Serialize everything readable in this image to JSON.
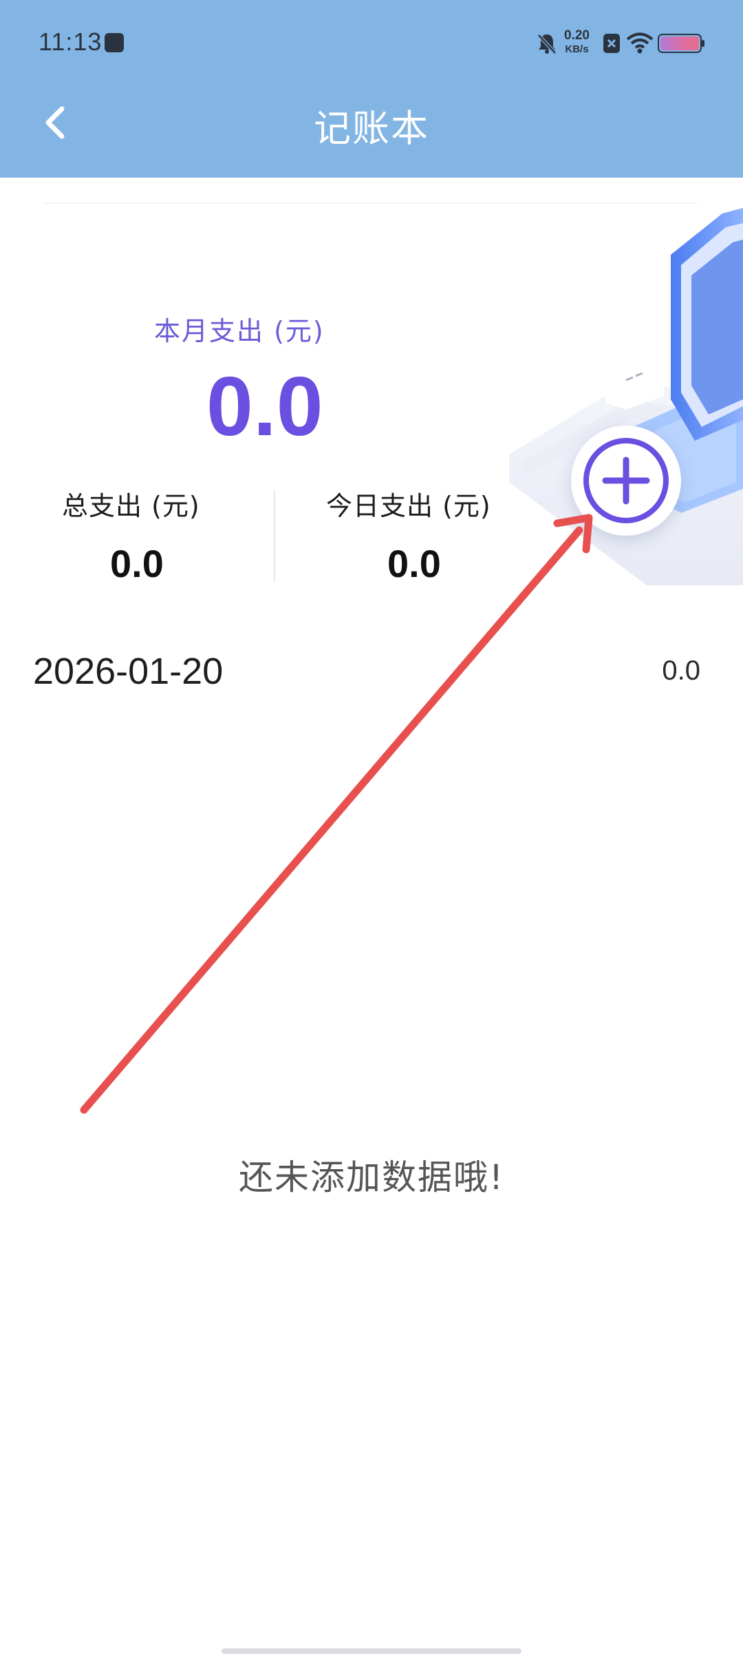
{
  "status_bar": {
    "time": "11:13",
    "net_speed_value": "0.20",
    "net_speed_unit": "KB/s"
  },
  "header": {
    "title": "记账本",
    "background_color": "#82b5e3"
  },
  "summary": {
    "month_label": "本月支出 (元)",
    "month_value": "0.0",
    "total_label": "总支出 (元)",
    "total_value": "0.0",
    "today_label": "今日支出 (元)",
    "today_value": "0.0",
    "accent_color": "#6a4fe0"
  },
  "day_row": {
    "date": "2026-01-20",
    "amount": "0.0"
  },
  "empty_state": {
    "message": "还未添加数据哦!"
  },
  "icons": {
    "back": "chevron-left-icon",
    "add": "plus-circle-icon",
    "silent": "bell-off-icon",
    "wifi": "wifi-icon",
    "battery": "battery-icon"
  },
  "annotation": {
    "arrow_color": "#e8504f"
  }
}
